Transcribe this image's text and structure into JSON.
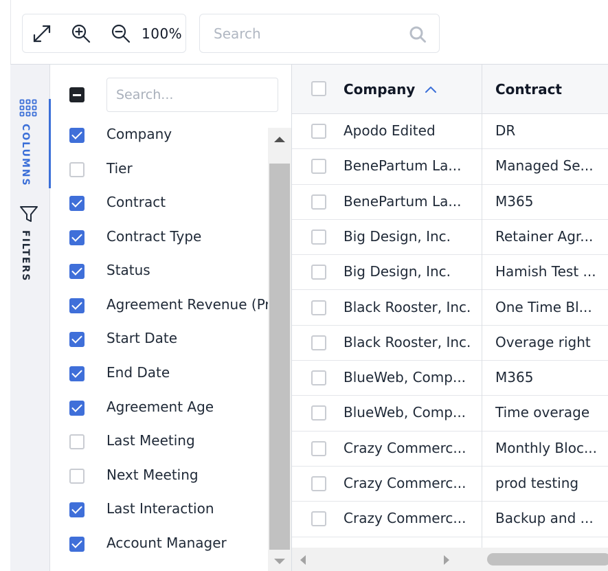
{
  "toolbar": {
    "zoom_level": "100%",
    "search_placeholder": "Search",
    "icons": [
      "expand-icon",
      "zoom-in-icon",
      "zoom-out-icon",
      "search-icon"
    ]
  },
  "side_rail": {
    "tabs": [
      {
        "label": "COLUMNS",
        "icon": "grid-dots-icon",
        "active": true,
        "color": "#3b6fd8"
      },
      {
        "label": "FILTERS",
        "icon": "filter-icon",
        "active": false,
        "color": "#1f2937"
      }
    ]
  },
  "column_panel": {
    "search_placeholder": "Search...",
    "select_all_state": "indeterminate",
    "items": [
      {
        "label": "Company",
        "checked": true
      },
      {
        "label": "Tier",
        "checked": false
      },
      {
        "label": "Contract",
        "checked": true
      },
      {
        "label": "Contract Type",
        "checked": true
      },
      {
        "label": "Status",
        "checked": true
      },
      {
        "label": "Agreement Revenue (Pr",
        "checked": true
      },
      {
        "label": "Start Date",
        "checked": true
      },
      {
        "label": "End Date",
        "checked": true
      },
      {
        "label": "Agreement Age",
        "checked": true
      },
      {
        "label": "Last Meeting",
        "checked": false
      },
      {
        "label": "Next Meeting",
        "checked": false
      },
      {
        "label": "Last Interaction",
        "checked": true
      },
      {
        "label": "Account Manager",
        "checked": true
      }
    ]
  },
  "grid": {
    "columns": [
      {
        "label": "Company",
        "sort": "ascending"
      },
      {
        "label": "Contract"
      }
    ],
    "rows": [
      {
        "company": "Apodo Edited",
        "contract": "DR"
      },
      {
        "company": "BenePartum La...",
        "contract": "Managed Se..."
      },
      {
        "company": "BenePartum La...",
        "contract": "M365"
      },
      {
        "company": "Big Design, Inc.",
        "contract": "Retainer Agr..."
      },
      {
        "company": "Big Design, Inc.",
        "contract": "Hamish Test ..."
      },
      {
        "company": "Black Rooster, Inc.",
        "contract": "One Time Bl..."
      },
      {
        "company": "Black Rooster, Inc.",
        "contract": "Overage right"
      },
      {
        "company": "BlueWeb, Comp...",
        "contract": "M365"
      },
      {
        "company": "BlueWeb, Comp...",
        "contract": "Time overage"
      },
      {
        "company": "Crazy Commerc...",
        "contract": "Monthly Bloc..."
      },
      {
        "company": "Crazy Commerc...",
        "contract": "prod testing"
      },
      {
        "company": "Crazy Commerc...",
        "contract": "Backup and ..."
      }
    ]
  },
  "colors": {
    "accent": "#3f6fd9",
    "rail_background": "#f1f2f6",
    "header_background": "#f6f7f9"
  }
}
